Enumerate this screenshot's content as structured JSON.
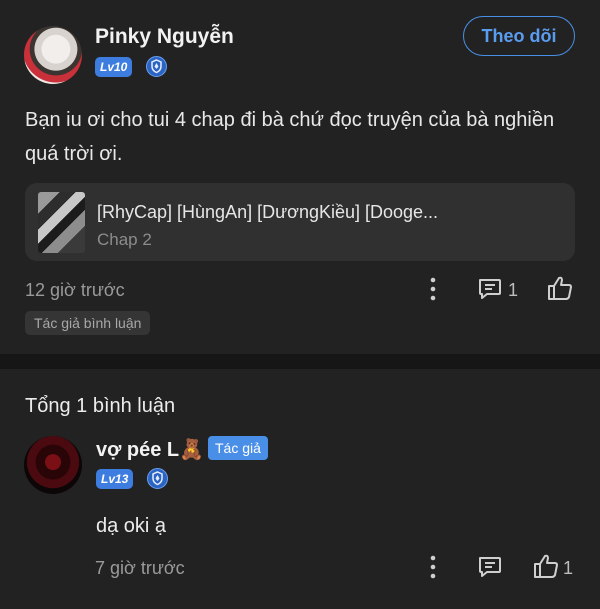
{
  "post": {
    "author": {
      "name": "Pinky Nguyễn",
      "level": "Lv10"
    },
    "follow_label": "Theo dõi",
    "text": "Bạn iu ơi cho tui 4 chap đi bà chứ đọc truyện của bà nghiền quá trời ơi.",
    "chapter": {
      "title": "[RhyCap] [HùngAn] [DươngKiều] [Dooge...",
      "subtitle": "Chap 2"
    },
    "time": "12 giờ trước",
    "comment_count": "1",
    "tag": "Tác giả bình luận"
  },
  "comments": {
    "total_label": "Tổng 1 bình luận",
    "reply": {
      "name": "vợ pée L🧸",
      "author_badge": "Tác giả",
      "level": "Lv13",
      "text": "dạ oki ạ",
      "time": "7 giờ trước",
      "like_count": "1"
    }
  },
  "colors": {
    "background": "#222222",
    "accent": "#4a8fe7"
  }
}
